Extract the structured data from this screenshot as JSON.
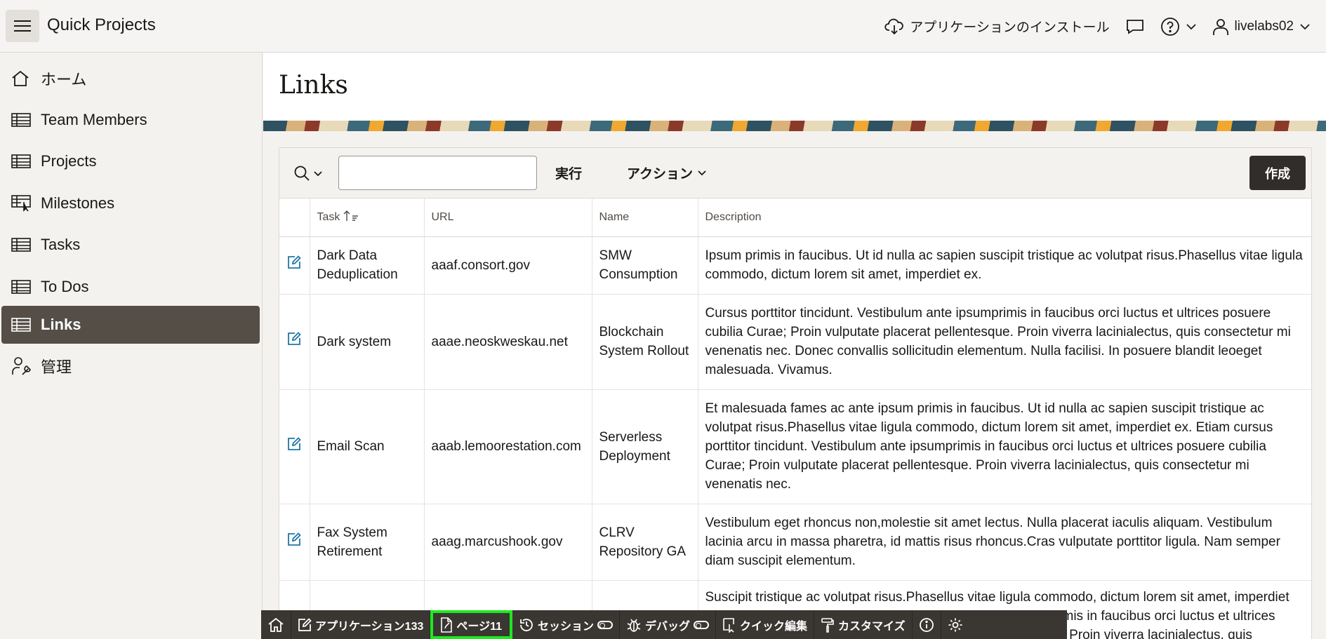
{
  "header": {
    "app_title": "Quick Projects",
    "install_label": "アプリケーションのインストール",
    "username": "livelabs02"
  },
  "sidebar": {
    "items": [
      {
        "label": "ホーム",
        "icon": "home-icon",
        "active": false
      },
      {
        "label": "Team Members",
        "icon": "table-icon",
        "active": false
      },
      {
        "label": "Projects",
        "icon": "table-icon",
        "active": false
      },
      {
        "label": "Milestones",
        "icon": "table-pointer-icon",
        "active": false
      },
      {
        "label": "Tasks",
        "icon": "table-icon",
        "active": false
      },
      {
        "label": "To Dos",
        "icon": "table-icon",
        "active": false
      },
      {
        "label": "Links",
        "icon": "table-icon",
        "active": true
      },
      {
        "label": "管理",
        "icon": "user-wrench-icon",
        "active": false
      }
    ]
  },
  "page": {
    "title": "Links"
  },
  "toolbar": {
    "search_value": "",
    "go_label": "実行",
    "actions_label": "アクション",
    "create_label": "作成"
  },
  "table": {
    "columns": [
      "",
      "Task",
      "URL",
      "Name",
      "Description"
    ],
    "rows": [
      {
        "task": "Dark Data Deduplication",
        "url": "aaaf.consort.gov",
        "name": "SMW Consumption",
        "description": "Ipsum primis in faucibus. Ut id nulla ac sapien suscipit tristique ac volutpat risus.Phasellus vitae ligula commodo, dictum lorem sit amet, imperdiet ex."
      },
      {
        "task": "Dark system",
        "url": "aaae.neoskweskau.net",
        "name": "Blockchain System Rollout",
        "description": "Cursus porttitor tincidunt. Vestibulum ante ipsumprimis in faucibus orci luctus et ultrices posuere cubilia Curae; Proin vulputate placerat pellentesque. Proin viverra lacinialectus, quis consectetur mi venenatis nec. Donec convallis sollicitudin elementum. Nulla facilisi. In posuere blandit leoeget malesuada. Vivamus."
      },
      {
        "task": "Email Scan",
        "url": "aaab.lemoorestation.com",
        "name": "Serverless Deployment",
        "description": "Et malesuada fames ac ante ipsum primis in faucibus. Ut id nulla ac sapien suscipit tristique ac volutpat risus.Phasellus vitae ligula commodo, dictum lorem sit amet, imperdiet ex. Etiam cursus porttitor tincidunt. Vestibulum ante ipsumprimis in faucibus orci luctus et ultrices posuere cubilia Curae; Proin vulputate placerat pellentesque. Proin viverra lacinialectus, quis consectetur mi venenatis nec."
      },
      {
        "task": "Fax System Retirement",
        "url": "aaag.marcushook.gov",
        "name": "CLRV Repository GA",
        "description": "Vestibulum eget rhoncus non,molestie sit amet lectus. Nulla placerat iaculis aliquam. Vestibulum lacinia arcu in massa pharetra, id mattis risus rhoncus.Cras vulputate porttitor ligula. Nam semper diam suscipit elementum."
      },
      {
        "task": "",
        "url": "",
        "name": "",
        "description": "Suscipit tristique ac volutpat risus.Phasellus vitae ligula commodo, dictum lorem sit amet, imperdiet ex. Etiam cursus porttitor tincidunt. Vestibulum ante ipsumprimis in faucibus orci luctus et ultrices posuere cubilia Curae; Proin vulputate placerat pellentesque. Proin viverra lacinialectus, quis"
      }
    ]
  },
  "devbar": {
    "application_label": "アプリケーション133",
    "page_label": "ページ11",
    "session_label": "セッション",
    "debug_label": "デバッグ",
    "quick_edit_label": "クイック編集",
    "customize_label": "カスタマイズ"
  },
  "colors": {
    "active_nav_bg": "#544e47",
    "create_btn_bg": "#312d2a",
    "edit_icon": "#1f77a8",
    "devbar_bg": "#3a3632",
    "highlight": "#1ee81e"
  }
}
